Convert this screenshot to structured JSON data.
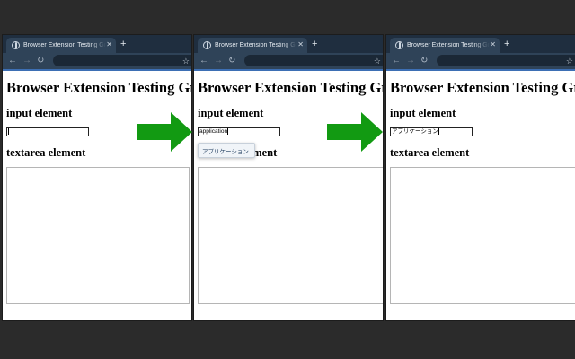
{
  "colors": {
    "background": "#2b2b2b",
    "tab_bar": "#1f2e3f",
    "toolbar": "#2f4358",
    "accent": "#3d6fb4",
    "arrow": "#129a12"
  },
  "browser": {
    "tab_title": "Browser Extension Testing Ground",
    "tab_icon": "globe-icon",
    "close_glyph": "✕",
    "newtab_glyph": "+",
    "back_glyph": "←",
    "forward_glyph": "→",
    "reload_glyph": "↻",
    "star_glyph": "☆"
  },
  "page": {
    "heading": "Browser Extension Testing Ground",
    "input_heading": "input element",
    "textarea_heading": "textarea element"
  },
  "steps": [
    {
      "input_value": ""
    },
    {
      "input_value": "application",
      "suggestion": "アプリケーション"
    },
    {
      "input_value": "アプリケーション"
    }
  ],
  "arrow_icon": "green-right-arrow-icon"
}
